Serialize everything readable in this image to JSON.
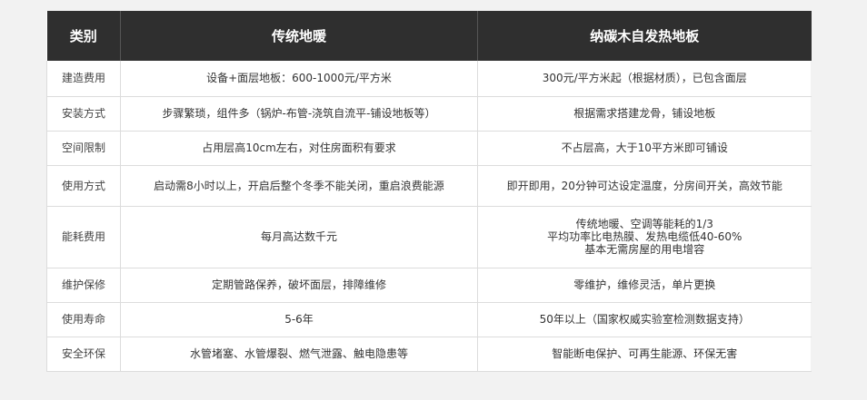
{
  "table": {
    "headers": [
      "类别",
      "传统地暖",
      "纳碳木自发热地板"
    ],
    "rows": [
      {
        "category": "建造费用",
        "traditional": "设备+面层地板：600-1000元/平方米",
        "nano": [
          "300元/平方米起（根据材质），已包含面层"
        ]
      },
      {
        "category": "安装方式",
        "traditional": "步骤繁琐，组件多（锅炉-布管-浇筑自流平-铺设地板等）",
        "nano": [
          "根据需求搭建龙骨，铺设地板"
        ]
      },
      {
        "category": "空间限制",
        "traditional": "占用层高10cm左右，对住房面积有要求",
        "nano": [
          "不占层高，大于10平方米即可铺设"
        ]
      },
      {
        "category": "使用方式",
        "traditional": "启动需8小时以上，开启后整个冬季不能关闭，重启浪费能源",
        "nano": [
          "即开即用，20分钟可达设定温度，分房间开关，高效节能"
        ]
      },
      {
        "category": "能耗费用",
        "traditional": "每月高达数千元",
        "nano": [
          "传统地暖、空调等能耗的1/3",
          "平均功率比电热膜、发热电缆低40-60%",
          "基本无需房屋的用电增容"
        ]
      },
      {
        "category": "维护保修",
        "traditional": "定期管路保养，破坏面层，排障维修",
        "nano": [
          "零维护，维修灵活，单片更换"
        ]
      },
      {
        "category": "使用寿命",
        "traditional": "5-6年",
        "nano": [
          "50年以上（国家权威实验室检测数据支持）"
        ]
      },
      {
        "category": "安全环保",
        "traditional": "水管堵塞、水管爆裂、燃气泄露、触电隐患等",
        "nano": [
          "智能断电保护、可再生能源、环保无害"
        ]
      }
    ]
  }
}
